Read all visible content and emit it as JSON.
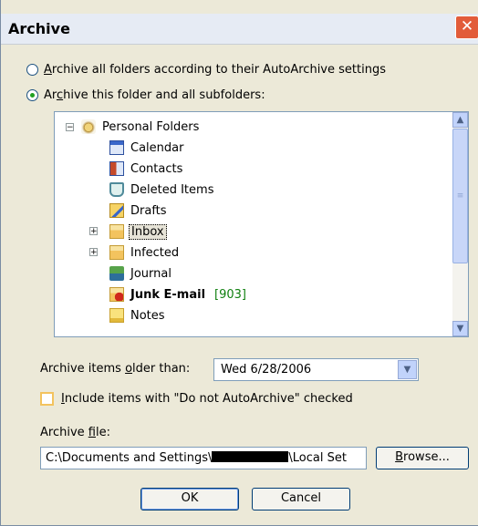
{
  "window": {
    "title": "Archive",
    "close_glyph": "✕"
  },
  "options": {
    "archive_all": {
      "pre": "",
      "accel": "A",
      "post": "rchive all folders according to their AutoArchive settings",
      "selected": false
    },
    "archive_this": {
      "pre": "Ar",
      "accel": "c",
      "post": "hive this folder and all subfolders:",
      "selected": true
    }
  },
  "tree": {
    "root": {
      "label": "Personal Folders",
      "expander": "⊟",
      "icon": "personal-folders-icon"
    },
    "items": [
      {
        "label": "Calendar",
        "icon": "calendar-icon",
        "expander": ""
      },
      {
        "label": "Contacts",
        "icon": "contacts-icon",
        "expander": ""
      },
      {
        "label": "Deleted Items",
        "icon": "deleted-items-icon",
        "expander": ""
      },
      {
        "label": "Drafts",
        "icon": "drafts-icon",
        "expander": ""
      },
      {
        "label": "Inbox",
        "icon": "inbox-icon",
        "expander": "+"
      },
      {
        "label": "Infected",
        "icon": "folder-icon",
        "expander": "+"
      },
      {
        "label": "Journal",
        "icon": "journal-icon",
        "expander": ""
      },
      {
        "label": "Junk E-mail",
        "icon": "junk-email-icon",
        "expander": "",
        "count": "[903]"
      },
      {
        "label": "Notes",
        "icon": "notes-icon",
        "expander": ""
      }
    ],
    "selected_item": "Inbox"
  },
  "archive_older": {
    "pre": "Archive items ",
    "accel": "o",
    "post": "lder than:",
    "value": "Wed 6/28/2006"
  },
  "include_checkbox": {
    "pre": "",
    "accel": "I",
    "post": "nclude items with \"Do not AutoArchive\" checked",
    "checked": false
  },
  "archive_file": {
    "pre": "Archive ",
    "accel": "f",
    "post": "ile:",
    "value_start": "C:\\Documents and Settings\\",
    "value_end": "\\Local Set"
  },
  "buttons": {
    "browse": {
      "accel": "B",
      "post": "rowse..."
    },
    "ok": "OK",
    "cancel": "Cancel"
  },
  "colors": {
    "title_bg": "#e6ebf4",
    "dialog_bg": "#ece9d8",
    "close_bg": "#e25c3a",
    "junk_count": "#108010",
    "border": "#7f9db9"
  }
}
